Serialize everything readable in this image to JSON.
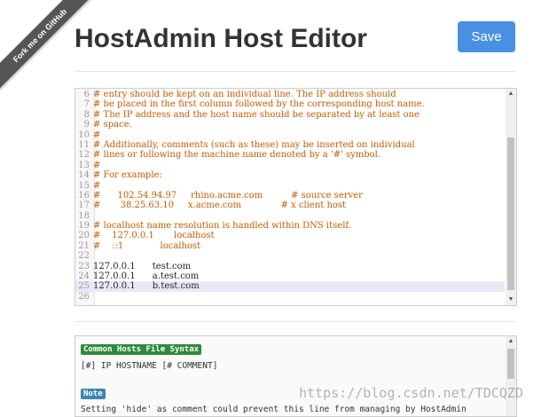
{
  "ribbon": {
    "label": "Fork me on GitHub"
  },
  "header": {
    "title": "HostAdmin Host Editor",
    "save_label": "Save"
  },
  "editor": {
    "lines": [
      {
        "num": "6",
        "text": "# entry should be kept on an individual line. The IP address should",
        "comment": true
      },
      {
        "num": "7",
        "text": "# be placed in the first column followed by the corresponding host name.",
        "comment": true
      },
      {
        "num": "8",
        "text": "# The IP address and the host name should be separated by at least one",
        "comment": true
      },
      {
        "num": "9",
        "text": "# space.",
        "comment": true
      },
      {
        "num": "10",
        "text": "#",
        "comment": true
      },
      {
        "num": "11",
        "text": "# Additionally, comments (such as these) may be inserted on individual",
        "comment": true
      },
      {
        "num": "12",
        "text": "# lines or following the machine name denoted by a '#' symbol.",
        "comment": true
      },
      {
        "num": "13",
        "text": "#",
        "comment": true
      },
      {
        "num": "14",
        "text": "# For example:",
        "comment": true
      },
      {
        "num": "15",
        "text": "#",
        "comment": true
      },
      {
        "num": "16",
        "text": "#      102.54.94.97     rhino.acme.com          # source server",
        "comment": true
      },
      {
        "num": "17",
        "text": "#       38.25.63.10     x.acme.com              # x client host",
        "comment": true
      },
      {
        "num": "18",
        "text": "",
        "comment": false
      },
      {
        "num": "19",
        "text": "# localhost name resolution is handled within DNS itself.",
        "comment": true
      },
      {
        "num": "20",
        "text": "#    127.0.0.1       localhost",
        "comment": true
      },
      {
        "num": "21",
        "text": "#    ::1             localhost",
        "comment": true
      },
      {
        "num": "22",
        "text": "",
        "comment": false
      },
      {
        "num": "23",
        "text": "127.0.0.1      test.com",
        "comment": false
      },
      {
        "num": "24",
        "text": "127.0.0.1      a.test.com",
        "comment": false
      },
      {
        "num": "25",
        "text": "127.0.0.1      b.test.com",
        "comment": false,
        "active": true
      },
      {
        "num": "26",
        "text": "",
        "comment": false
      }
    ],
    "scroll_up": "▲",
    "scroll_down": "▼"
  },
  "help": {
    "syntax_badge": "Common Hosts File Syntax",
    "syntax_text": "[#] IP HOSTNAME [# COMMENT]",
    "note_badge": "Note",
    "note_text": "Setting 'hide' as comment could prevent this line from managing by HostAdmin"
  },
  "watermark": "https://blog.csdn.net/TDCQZD",
  "colors": {
    "accent": "#4a90e2",
    "comment": "#c25b00",
    "syntax_badge": "#2e8b3d",
    "note_badge": "#3a87ad"
  }
}
